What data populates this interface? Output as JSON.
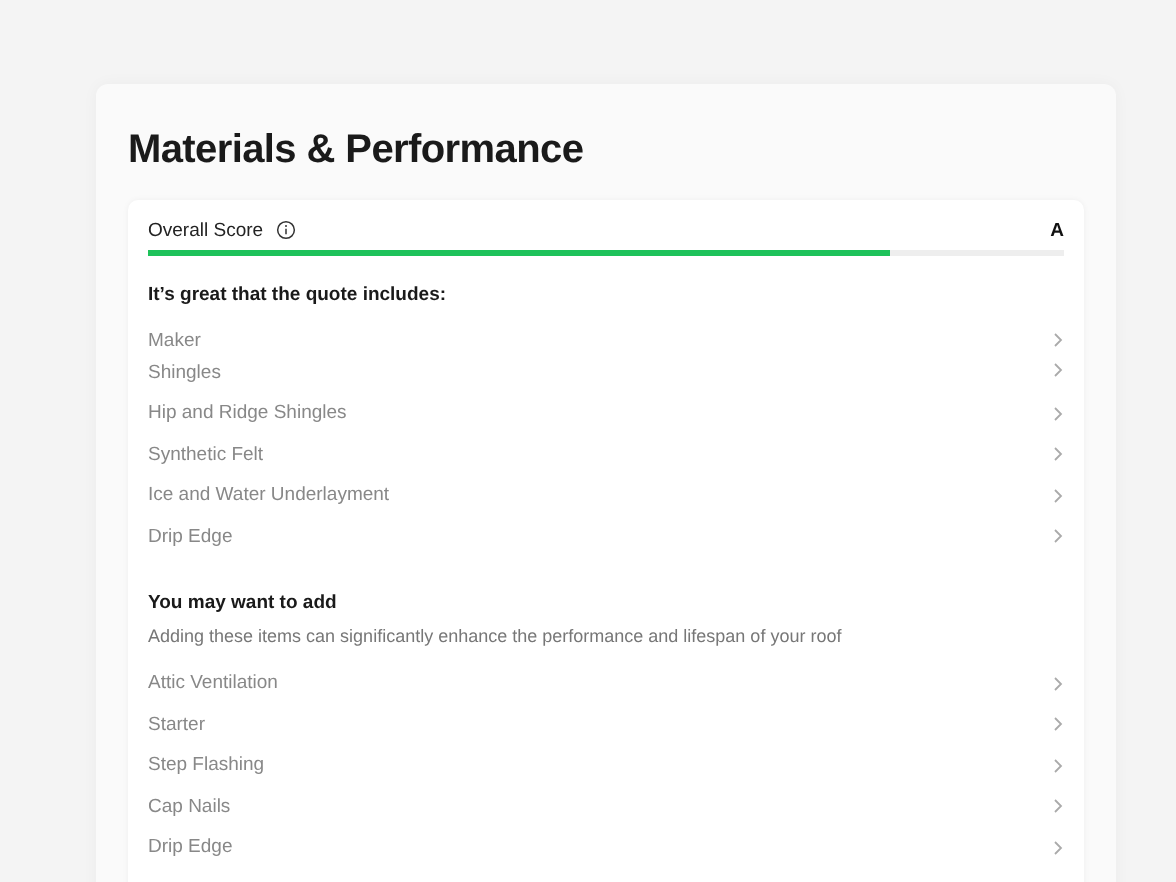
{
  "title": "Materials & Performance",
  "score": {
    "label": "Overall Score",
    "grade": "A",
    "level": 0.81
  },
  "included": {
    "heading": "It’s great that the quote includes:",
    "items": [
      {
        "label": "Maker",
        "kind": "normal"
      },
      {
        "label": "Shingles",
        "kind": "compact"
      },
      {
        "label": "Hip and Ridge Shingles",
        "kind": "normal"
      },
      {
        "label": "Synthetic Felt",
        "kind": "normal"
      },
      {
        "label": "Ice and Water Underlayment",
        "kind": "normal"
      },
      {
        "label": "Drip Edge",
        "kind": "normal"
      }
    ]
  },
  "suggested": {
    "heading": "You may want to add",
    "description": "Adding these items can significantly enhance the performance and lifespan of your roof",
    "items": [
      {
        "label": "Attic Ventilation"
      },
      {
        "label": "Starter"
      },
      {
        "label": "Step Flashing"
      },
      {
        "label": "Cap Nails"
      },
      {
        "label": "Drip Edge"
      }
    ]
  }
}
